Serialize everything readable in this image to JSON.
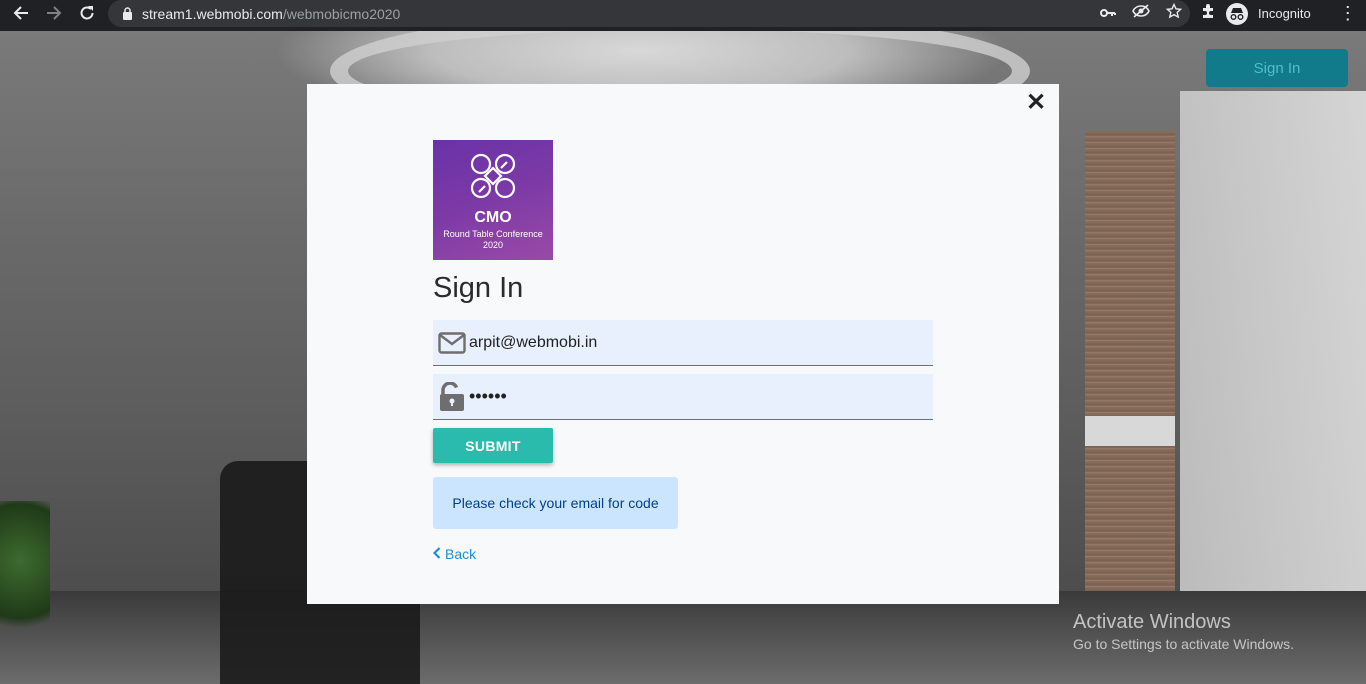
{
  "browser": {
    "url_host": "stream1.webmobi.com",
    "url_path": "/webmobicmo2020",
    "profile_label": "Incognito"
  },
  "page": {
    "signin_button": "Sign In"
  },
  "modal": {
    "close_glyph": "✕",
    "logo": {
      "title": "CMO",
      "subtitle": "Round Table Conference 2020"
    },
    "heading": "Sign In",
    "email_value": "arpit@webmobi.in",
    "password_value": "••••••",
    "submit_label": "SUBMIT",
    "alert_text": "Please check your email for code",
    "back_label": "Back"
  },
  "watermark": {
    "title": "Activate Windows",
    "subtitle": "Go to Settings to activate Windows."
  },
  "colors": {
    "submit": "#2bbbad",
    "alert_bg": "#cce5ff",
    "link": "#1a8fd6",
    "page_button": "#117a8b"
  }
}
